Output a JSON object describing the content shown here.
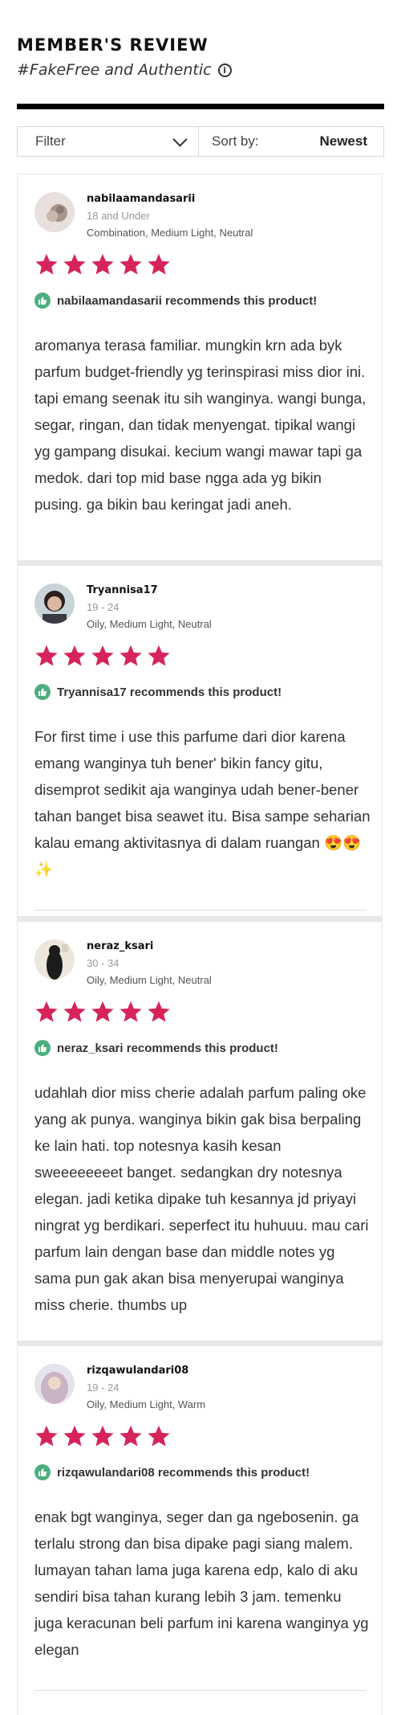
{
  "header": {
    "title": "MEMBER'S REVIEW",
    "subtitle": "#FakeFree and Authentic"
  },
  "toolbar": {
    "filter_label": "Filter",
    "sort_label": "Sort by:",
    "sort_value": "Newest"
  },
  "colors": {
    "star": "#d6245a",
    "recommend": "#4caf7d"
  },
  "reviews": [
    {
      "username": "nabilaamandasarii",
      "age": "18 and Under",
      "skin": "Combination, Medium Light, Neutral",
      "rating": 5,
      "recommend": "nabilaamandasarii recommends this product!",
      "text": "aromanya terasa familiar. mungkin krn ada byk parfum budget-friendly yg terinspirasi miss dior ini. tapi emang seenak itu sih wanginya. wangi bunga, segar, ringan, dan tidak menyengat. tipikal wangi yg gampang disukai. kecium wangi mawar tapi ga medok. dari top mid base ngga ada yg bikin pusing. ga bikin bau keringat jadi aneh."
    },
    {
      "username": "Tryannisa17",
      "age": "19 - 24",
      "skin": "Oily, Medium Light, Neutral",
      "rating": 5,
      "recommend": "Tryannisa17 recommends this product!",
      "text": "For first time i use this parfume dari dior karena emang wanginya tuh bener' bikin fancy gitu, disemprot sedikit aja wanginya udah bener-bener tahan banget bisa seawet itu. Bisa sampe seharian kalau emang aktivitasnya di dalam ruangan 😍😍✨"
    },
    {
      "username": "neraz_ksari",
      "age": "30 - 34",
      "skin": "Oily, Medium Light, Neutral",
      "rating": 5,
      "recommend": "neraz_ksari recommends this product!",
      "text": "udahlah dior miss cherie adalah parfum paling oke yang ak punya. wanginya bikin gak bisa berpaling ke lain hati. top notesnya kasih kesan sweeeeeeeet banget. sedangkan dry notesnya elegan. jadi ketika dipake tuh kesannya jd priyayi ningrat yg berdikari. seperfect itu huhuuu. mau cari parfum lain dengan base dan middle notes yg sama pun gak akan bisa menyerupai wanginya miss cherie. thumbs up"
    },
    {
      "username": "rizqawulandari08",
      "age": "19 - 24",
      "skin": "Oily, Medium Light, Warm",
      "rating": 5,
      "recommend": "rizqawulandari08 recommends this product!",
      "text": "enak bgt wanginya, seger dan ga ngebosenin. ga terlalu strong dan bisa dipake pagi siang malem. lumayan tahan lama juga karena edp, kalo di aku sendiri bisa tahan kurang lebih 3 jam. temenku juga keracunan beli parfum ini karena wanginya yg elegan"
    }
  ]
}
